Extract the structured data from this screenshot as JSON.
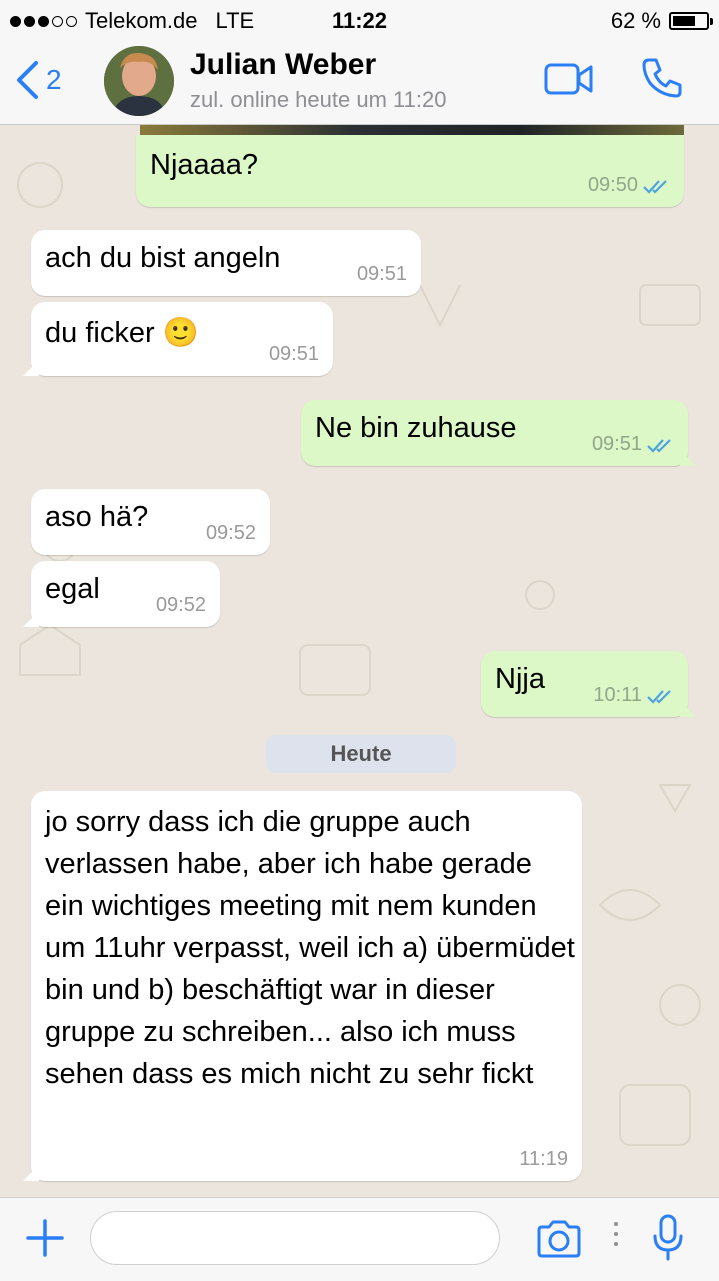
{
  "status_bar": {
    "carrier": "Telekom.de",
    "network": "LTE",
    "time": "11:22",
    "battery": "62 %",
    "battery_level": 0.62,
    "signal_bars_filled": 3,
    "signal_bars_total": 5
  },
  "header": {
    "back_count": "2",
    "contact_name": "Julian Weber",
    "contact_status": "zul. online heute um 11:20",
    "icons": [
      "back-chevron-icon",
      "video-call-icon",
      "phone-icon"
    ]
  },
  "messages": [
    {
      "direction": "out",
      "text": "Njaaaa?",
      "time": "09:50",
      "read": true
    },
    {
      "direction": "in",
      "text": "ach du bist angeln",
      "time": "09:51"
    },
    {
      "direction": "in",
      "text": "du ficker 🙂",
      "time": "09:51"
    },
    {
      "direction": "out",
      "text": "Ne bin zuhause",
      "time": "09:51",
      "read": true
    },
    {
      "direction": "in",
      "text": "aso hä?",
      "time": "09:52"
    },
    {
      "direction": "in",
      "text": "egal",
      "time": "09:52"
    },
    {
      "direction": "out",
      "text": "Njja",
      "time": "10:11",
      "read": true
    }
  ],
  "date_separator": "Heute",
  "last_message": {
    "direction": "in",
    "text": "jo sorry dass ich die gruppe auch verlassen habe, aber ich habe gerade ein wichtiges meeting mit nem kunden um 11uhr verpasst, weil ich a) übermüdet bin und b) beschäftigt war in dieser gruppe zu schreiben... also ich muss sehen dass es mich nicht zu sehr fickt",
    "time": "11:19"
  },
  "input_bar": {
    "placeholder": "",
    "icons": [
      "plus-icon",
      "camera-icon",
      "more-icon",
      "microphone-icon"
    ]
  },
  "colors": {
    "accent": "#2a7ff6",
    "outgoing_bubble": "#dcf8c6",
    "incoming_bubble": "#ffffff",
    "read_ticks": "#4fa3e0",
    "chat_background": "#ece5dd"
  }
}
